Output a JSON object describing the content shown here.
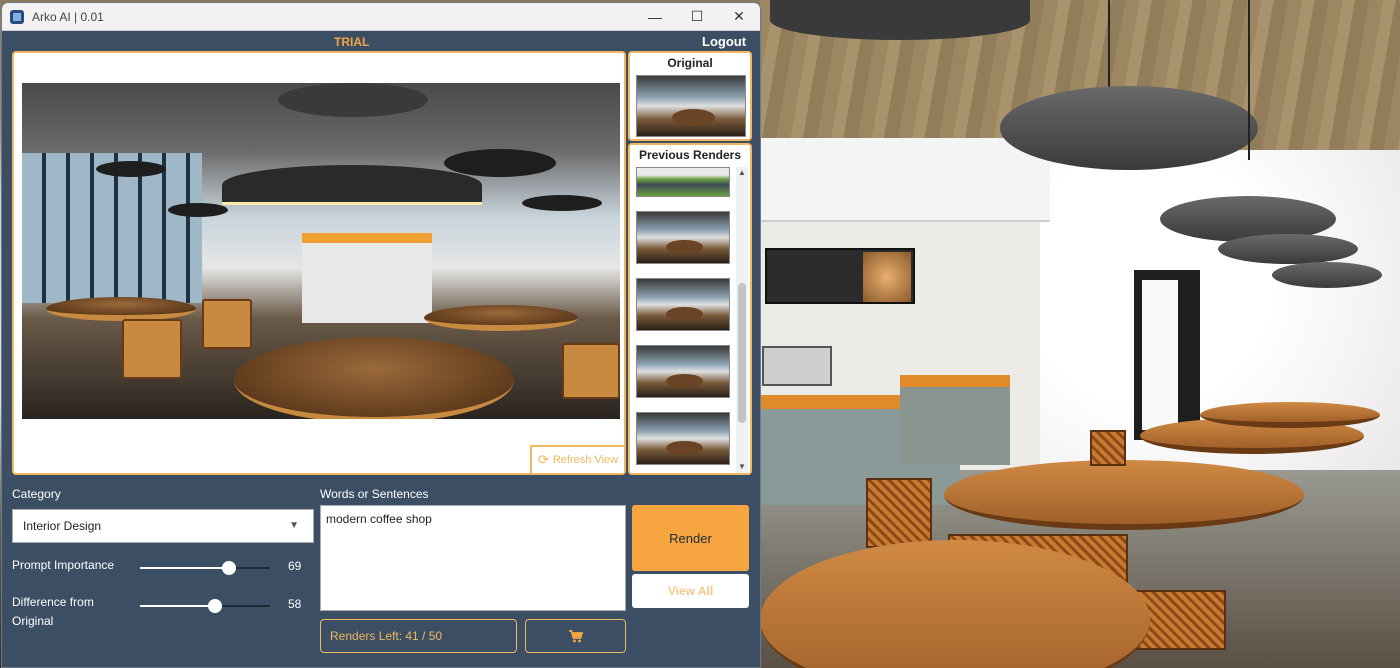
{
  "window": {
    "title": "Arko AI | 0.01"
  },
  "header": {
    "status": "TRIAL",
    "logout_label": "Logout"
  },
  "viewer": {
    "refresh_label": "Refresh View"
  },
  "side_panel": {
    "original_title": "Original",
    "previous_title": "Previous Renders",
    "previous_count": 5
  },
  "controls": {
    "category_label": "Category",
    "category_value": "Interior Design",
    "prompt_importance_label": "Prompt Importance",
    "prompt_importance_value": "69",
    "difference_label": "Difference from Original",
    "difference_value": "58",
    "words_label": "Words or Sentences",
    "prompt_text": "modern coffee shop",
    "render_label": "Render",
    "view_all_label": "View All",
    "renders_left": "Renders Left: 41 / 50"
  },
  "icons": {
    "refresh": "refresh-icon",
    "cart": "cart-icon",
    "dropdown": "chevron-down-icon"
  },
  "colors": {
    "accent": "#f7a540",
    "panel": "#3b4e64",
    "border": "#f0b860"
  }
}
